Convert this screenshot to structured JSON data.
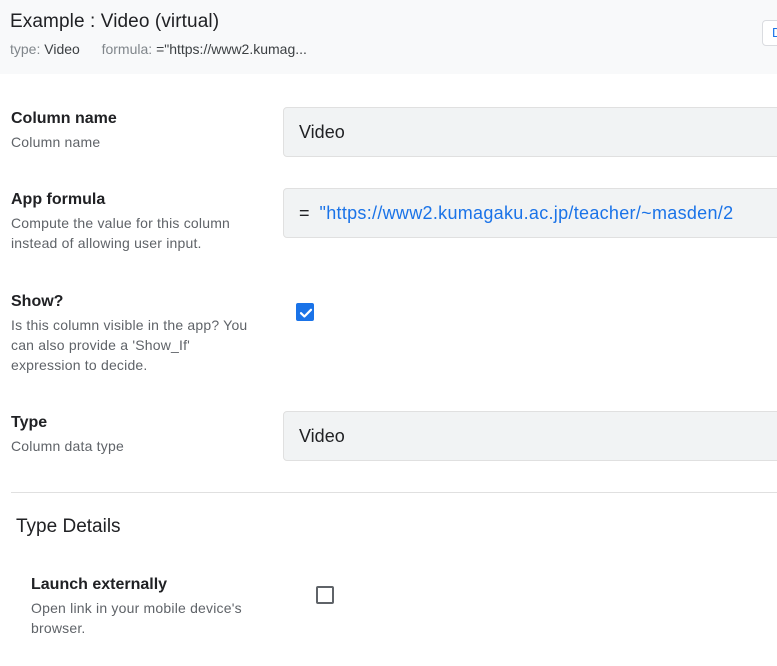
{
  "header": {
    "title": "Example : Video (virtual)",
    "type_key": "type:",
    "type_value": "Video",
    "formula_key": "formula:",
    "formula_value": "=\"https://www2.kumag...",
    "button_label": "D"
  },
  "fields": {
    "column_name": {
      "label": "Column name",
      "description": "Column name",
      "value": "Video"
    },
    "app_formula": {
      "label": "App formula",
      "description": "Compute the value for this column instead of allowing user input.",
      "eq": "=",
      "value": "\"https://www2.kumagaku.ac.jp/teacher/~masden/2"
    },
    "show": {
      "label": "Show?",
      "description": "Is this column visible in the app? You can also provide a 'Show_If' expression to decide.",
      "checked": true
    },
    "type": {
      "label": "Type",
      "description": "Column data type",
      "value": "Video"
    }
  },
  "type_details": {
    "heading": "Type Details",
    "launch_externally": {
      "label": "Launch externally",
      "description": "Open link in your mobile device's browser.",
      "checked": false
    }
  },
  "colors": {
    "accent": "#1a73e8",
    "header_bg": "#f8f9fa",
    "field_bg": "#f1f3f4"
  }
}
